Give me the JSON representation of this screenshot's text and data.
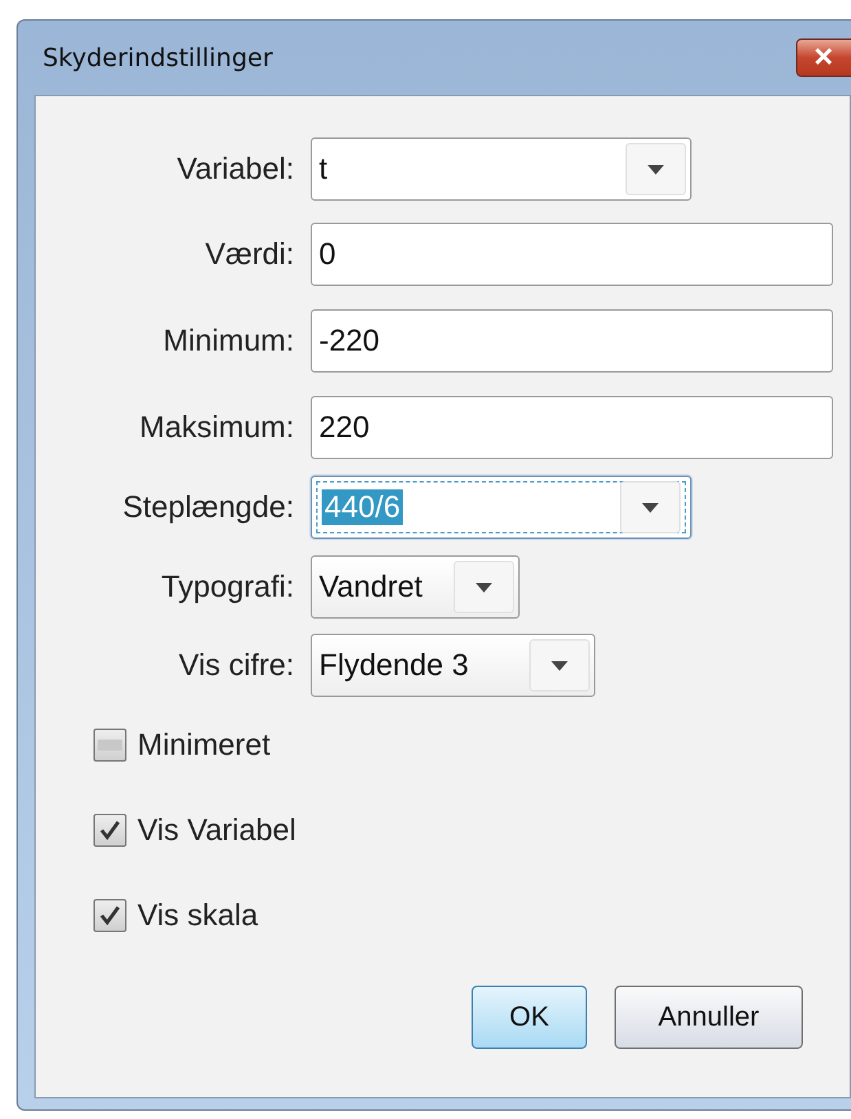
{
  "window": {
    "title": "Skyderindstillinger",
    "close": "×"
  },
  "fields": [
    {
      "label": "Variabel:",
      "kind": "combo",
      "value": "t",
      "focused": false
    },
    {
      "label": "Værdi:",
      "kind": "text",
      "value": "0",
      "focused": false
    },
    {
      "label": "Minimum:",
      "kind": "text",
      "value": "-220",
      "focused": false
    },
    {
      "label": "Maksimum:",
      "kind": "text",
      "value": "220",
      "focused": false
    },
    {
      "label": "Steplængde:",
      "kind": "combo",
      "value": "440/6",
      "focused": true
    },
    {
      "label": "Typografi:",
      "kind": "combo",
      "value": "Vandret",
      "focused": false
    },
    {
      "label": "Vis cifre:",
      "kind": "combo",
      "value": "Flydende 3",
      "focused": false
    }
  ],
  "checkboxes": [
    {
      "label": "Minimeret",
      "checked": false
    },
    {
      "label": "Vis Variabel",
      "checked": true
    },
    {
      "label": "Vis skala",
      "checked": true
    }
  ],
  "buttons": [
    {
      "label": "OK",
      "default": true
    },
    {
      "label": "Annuller",
      "default": false
    }
  ]
}
